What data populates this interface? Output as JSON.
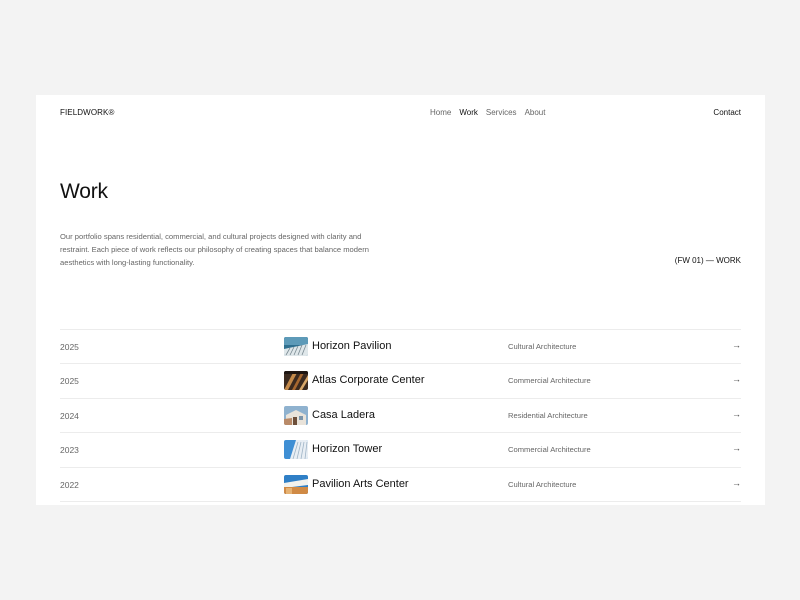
{
  "brand": "FIELDWORK®",
  "nav": {
    "links": [
      "Home",
      "Work",
      "Services",
      "About"
    ],
    "active": "Work",
    "contact": "Contact"
  },
  "page": {
    "title": "Work",
    "description": "Our portfolio spans residential, commercial, and cultural projects designed with clarity and restraint. Each piece of work reflects our philosophy of creating spaces that balance modern aesthetics with long-lasting functionality.",
    "ref": "(FW 01) — WORK"
  },
  "projects": [
    {
      "year": "2025",
      "name": "Horizon Pavilion",
      "category": "Cultural Architecture",
      "arrow": "→",
      "thumb": "pavilion-thumbnail"
    },
    {
      "year": "2025",
      "name": "Atlas Corporate Center",
      "category": "Commercial Architecture",
      "arrow": "→",
      "thumb": "atlas-thumbnail"
    },
    {
      "year": "2024",
      "name": "Casa Ladera",
      "category": "Residential Architecture",
      "arrow": "→",
      "thumb": "casa-thumbnail"
    },
    {
      "year": "2023",
      "name": "Horizon Tower",
      "category": "Commercial Architecture",
      "arrow": "→",
      "thumb": "tower-thumbnail"
    },
    {
      "year": "2022",
      "name": "Pavilion Arts Center",
      "category": "Cultural Architecture",
      "arrow": "→",
      "thumb": "arts-thumbnail"
    }
  ]
}
